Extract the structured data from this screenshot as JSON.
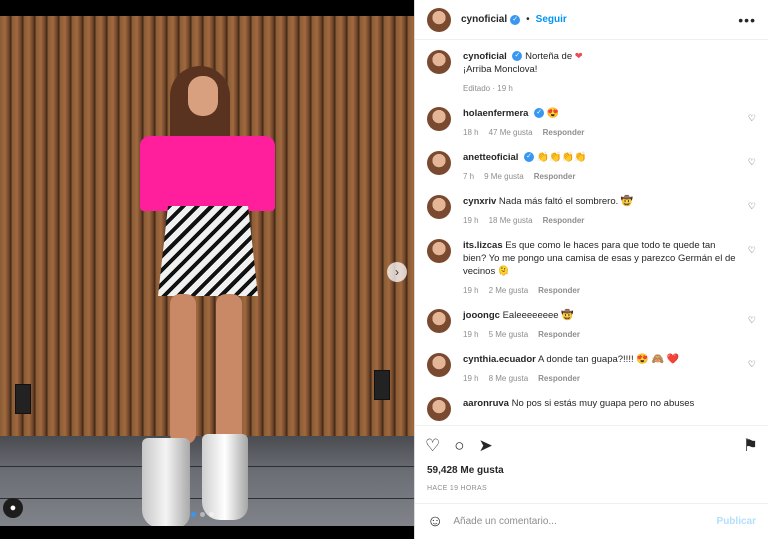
{
  "post": {
    "username": "cynoficial",
    "follow_label": "Seguir",
    "separator": "•",
    "more_icon": "more-horizontal-icon",
    "caption_line1": "Norteña de",
    "caption_line2": "¡Arriba Monclova!",
    "caption_meta": "Editado · 19 h",
    "likes": "59,428 Me gusta",
    "time_ago": "HACE 19 HORAS",
    "comment_placeholder": "Añade un comentario...",
    "publish_label": "Publicar"
  },
  "comments": [
    {
      "user": "holaenfermera",
      "text": "",
      "emoji": "😍",
      "time": "18 h",
      "likes": "47 Me gusta",
      "reply": "Responder",
      "verified": true
    },
    {
      "user": "anetteoficial",
      "text": "",
      "emoji": "👏👏👏👏",
      "time": "7 h",
      "likes": "9 Me gusta",
      "reply": "Responder",
      "verified": true
    },
    {
      "user": "cynxriv",
      "text": "Nada más faltó el sombrero.",
      "emoji": "🤠",
      "time": "19 h",
      "likes": "18 Me gusta",
      "reply": "Responder",
      "verified": false
    },
    {
      "user": "its.lizcas",
      "text": "Es que como le haces para que todo te quede tan bien? Yo me pongo una camisa de esas y parezco Germán el de vecinos 🫠",
      "emoji": "",
      "time": "19 h",
      "likes": "2 Me gusta",
      "reply": "Responder",
      "verified": false
    },
    {
      "user": "jooongc",
      "text": "Ealeeeeeeee",
      "emoji": "🤠",
      "time": "19 h",
      "likes": "5 Me gusta",
      "reply": "Responder",
      "verified": false
    },
    {
      "user": "cynthia.ecuador",
      "text": "A donde tan guapa?!!!!",
      "emoji": "😍 🙈 ❤️",
      "time": "19 h",
      "likes": "8 Me gusta",
      "reply": "Responder",
      "verified": false
    },
    {
      "user": "aaronruva",
      "text": "No pos si estás muy guapa pero no abuses",
      "emoji": "",
      "time": "",
      "likes": "",
      "reply": "",
      "verified": false
    }
  ],
  "colors": {
    "accent": "#0095f6",
    "verified": "#3897f0",
    "heart": "#ed4956",
    "shirt": "#ff1f9c"
  }
}
